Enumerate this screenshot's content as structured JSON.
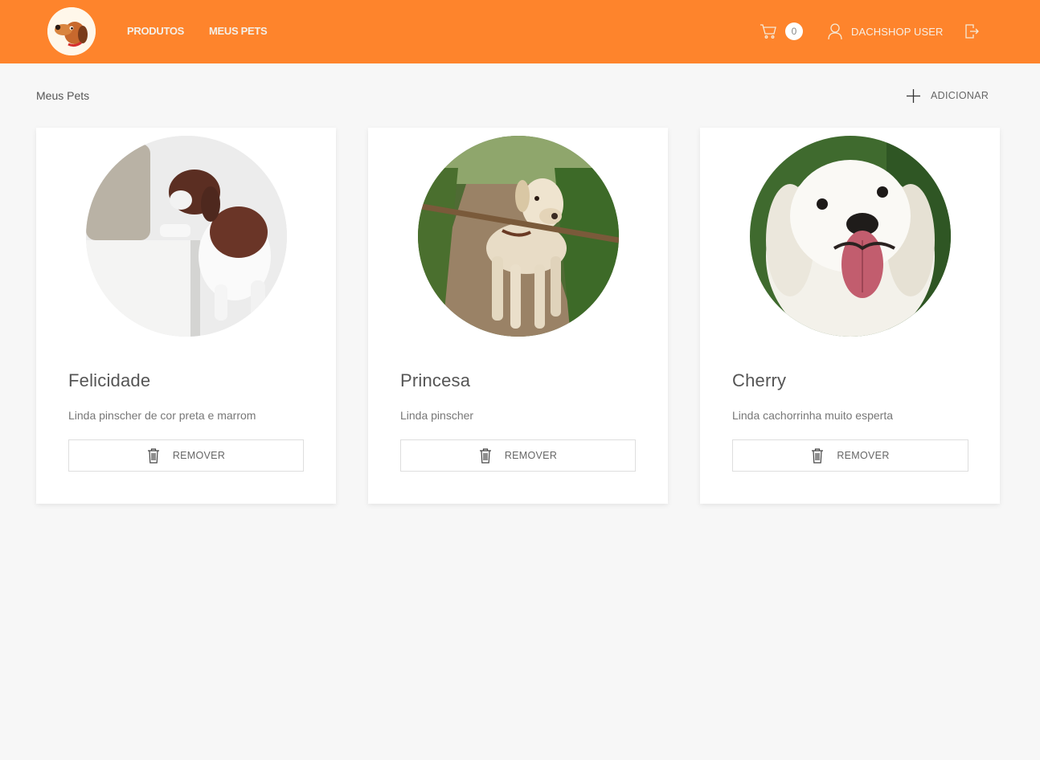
{
  "header": {
    "nav": [
      {
        "label": "PRODUTOS"
      },
      {
        "label": "MEUS PETS"
      }
    ],
    "cart_count": "0",
    "user_name": "DACHSHOP USER",
    "colors": {
      "brand": "#fe842c",
      "nav_text": "#f3f0ea"
    },
    "icons": {
      "logo": "dachshund-logo-icon",
      "cart": "cart-icon",
      "user": "user-icon",
      "logout": "logout-icon"
    }
  },
  "page": {
    "title": "Meus Pets",
    "add_label": "ADICIONAR",
    "add_icon": "plus-icon"
  },
  "pets": [
    {
      "name": "Felicidade",
      "description": "Linda pinscher de cor preta e marrom",
      "remove_label": "REMOVER"
    },
    {
      "name": "Princesa",
      "description": "Linda pinscher",
      "remove_label": "REMOVER"
    },
    {
      "name": "Cherry",
      "description": "Linda cachorrinha muito esperta",
      "remove_label": "REMOVER"
    }
  ]
}
